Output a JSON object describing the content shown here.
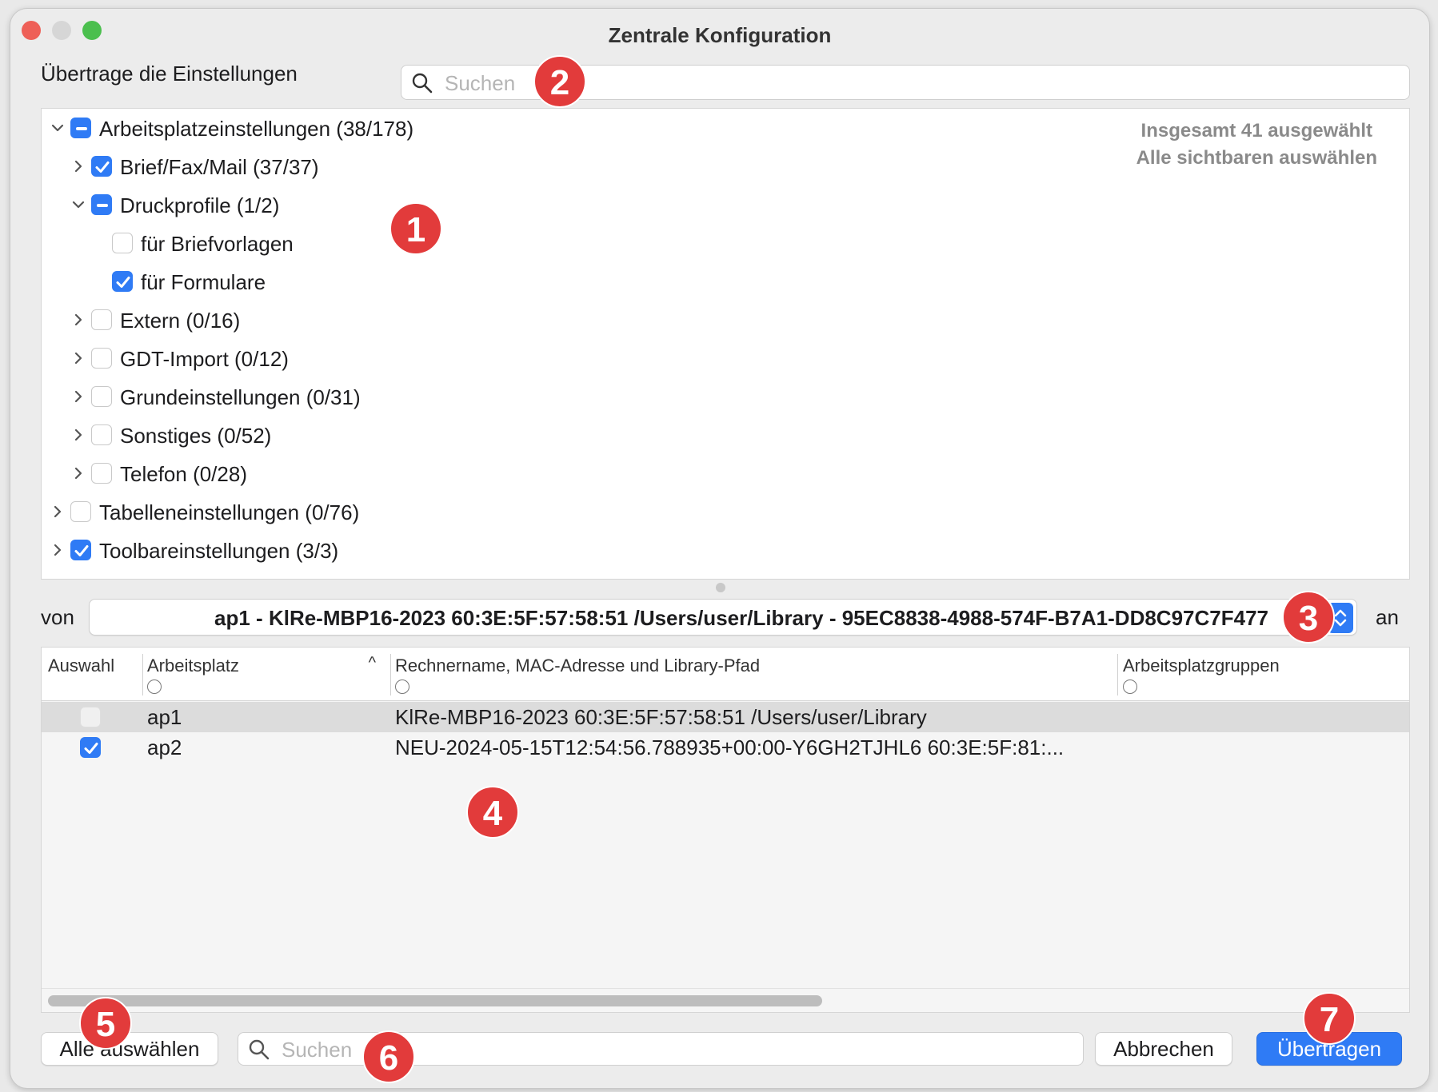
{
  "window": {
    "title": "Zentrale Konfiguration",
    "traffic_lights": {
      "close": "#ee5f57",
      "minimize": "#d8d8d8",
      "zoom": "#4bbf4e"
    }
  },
  "transfer": {
    "label": "Übertrage die Einstellungen",
    "search_placeholder": "Suchen"
  },
  "tree": {
    "summary_line1": "Insgesamt 41 ausgewählt",
    "summary_line2": "Alle sichtbaren auswählen",
    "items": [
      {
        "label": "Arbeitsplatzeinstellungen (38/178)",
        "state": "mixed",
        "expand": "down"
      },
      {
        "label": "Brief/Fax/Mail (37/37)",
        "state": "checked",
        "expand": "right"
      },
      {
        "label": "Druckprofile (1/2)",
        "state": "mixed",
        "expand": "down"
      },
      {
        "label": "für Briefvorlagen",
        "state": "unchecked",
        "expand": "none"
      },
      {
        "label": "für Formulare",
        "state": "checked",
        "expand": "none"
      },
      {
        "label": "Extern (0/16)",
        "state": "unchecked",
        "expand": "right"
      },
      {
        "label": "GDT-Import (0/12)",
        "state": "unchecked",
        "expand": "right"
      },
      {
        "label": "Grundeinstellungen (0/31)",
        "state": "unchecked",
        "expand": "right"
      },
      {
        "label": "Sonstiges (0/52)",
        "state": "unchecked",
        "expand": "right"
      },
      {
        "label": "Telefon (0/28)",
        "state": "unchecked",
        "expand": "right"
      },
      {
        "label": "Tabelleneinstellungen (0/76)",
        "state": "unchecked",
        "expand": "right"
      },
      {
        "label": "Toolbareinstellungen (3/3)",
        "state": "checked",
        "expand": "right"
      }
    ]
  },
  "source": {
    "from_label": "von",
    "to_label": "an",
    "selected": "ap1 - KlRe-MBP16-2023 60:3E:5F:57:58:51 /Users/user/Library - 95EC8838-4988-574F-B7A1-DD8C97C7F477"
  },
  "table": {
    "columns": [
      "Auswahl",
      "Arbeitsplatz",
      "Rechnername, MAC-Adresse und Library-Pfad",
      "Arbeitsplatzgruppen"
    ],
    "sort_indicator": "^",
    "rows": [
      {
        "selected": false,
        "workplace": "ap1",
        "host": "KlRe-MBP16-2023 60:3E:5F:57:58:51 /Users/user/Library",
        "groups": ""
      },
      {
        "selected": true,
        "workplace": "ap2",
        "host": "NEU-2024-05-15T12:54:56.788935+00:00-Y6GH2TJHL6 60:3E:5F:81:...",
        "groups": ""
      }
    ]
  },
  "footer": {
    "select_all": "Alle auswählen",
    "search_placeholder": "Suchen",
    "cancel": "Abbrechen",
    "transfer": "Übertragen"
  },
  "badges": [
    "1",
    "2",
    "3",
    "4",
    "5",
    "6",
    "7"
  ],
  "colors": {
    "accent": "#2f7bf5",
    "badge": "#e23b3b"
  }
}
